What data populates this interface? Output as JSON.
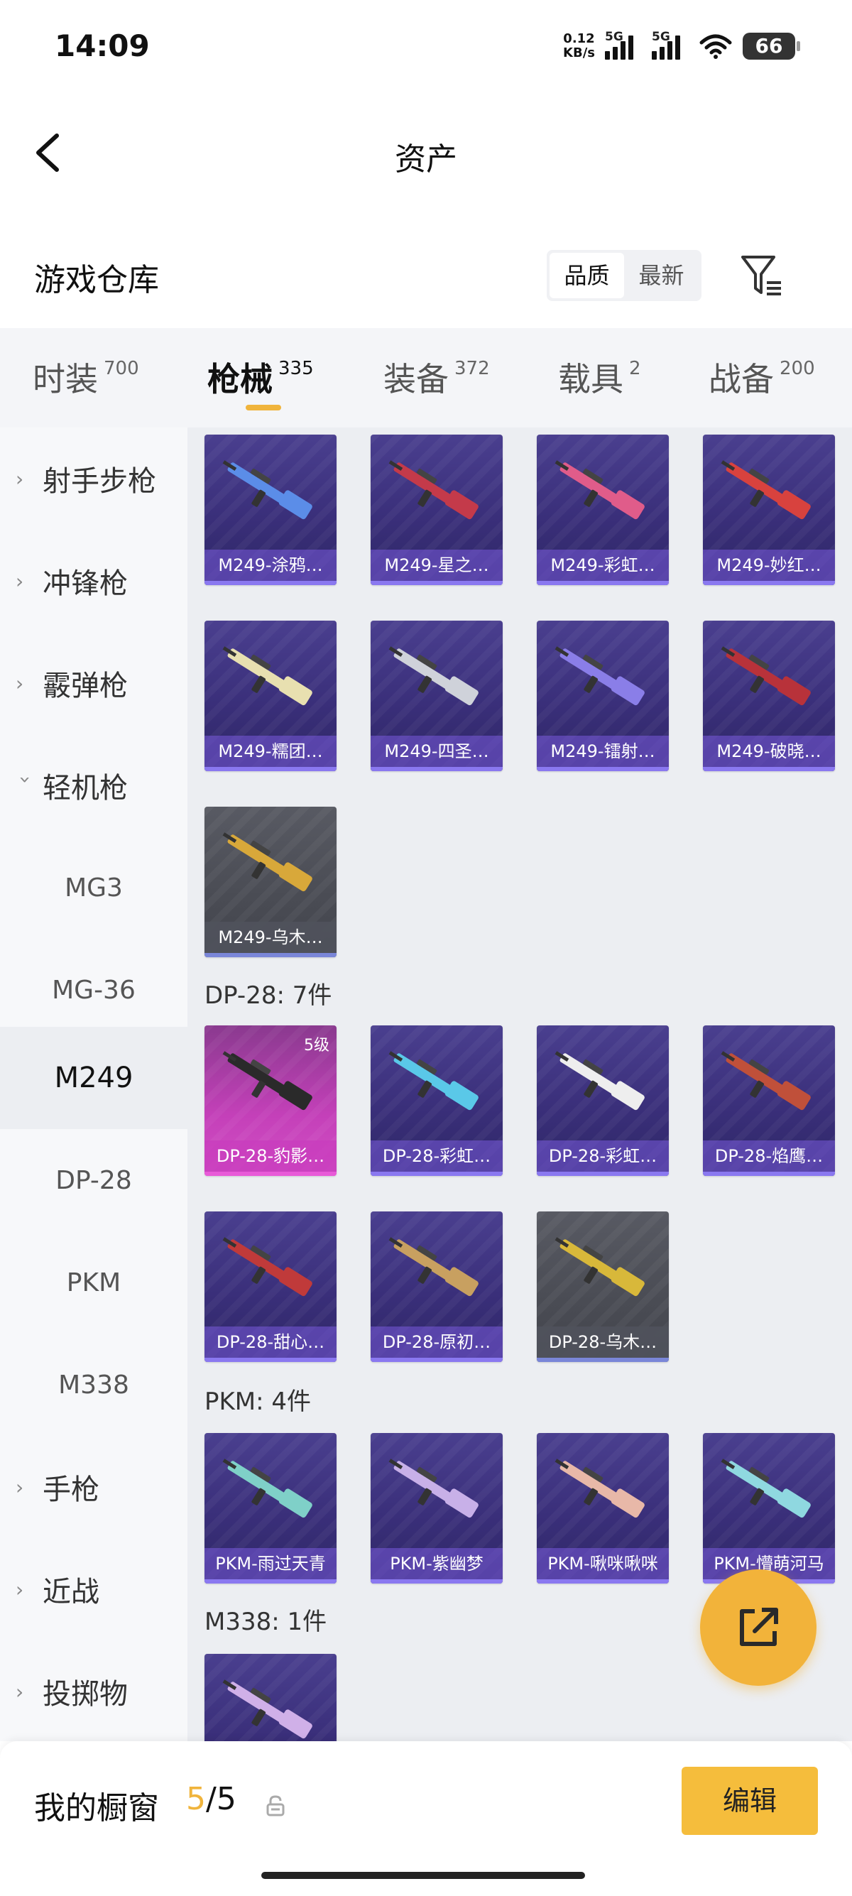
{
  "status_bar": {
    "time": "14:09",
    "net_speed_value": "0.12",
    "net_speed_unit": "KB/s",
    "sig1": "5G",
    "sig2": "5G",
    "battery": "66"
  },
  "nav": {
    "title": "资产"
  },
  "warehouse": {
    "title": "游戏仓库",
    "sort_quality": "品质",
    "sort_newest": "最新"
  },
  "tabs": [
    {
      "label": "时装",
      "count": "700"
    },
    {
      "label": "枪械",
      "count": "335"
    },
    {
      "label": "装备",
      "count": "372"
    },
    {
      "label": "载具",
      "count": "2"
    },
    {
      "label": "战备",
      "count": "200"
    }
  ],
  "sidebar": [
    {
      "label": "射手步枪"
    },
    {
      "label": "冲锋枪"
    },
    {
      "label": "霰弹枪"
    },
    {
      "label": "轻机枪"
    },
    {
      "label": "MG3"
    },
    {
      "label": "MG-36"
    },
    {
      "label": "M249"
    },
    {
      "label": "DP-28"
    },
    {
      "label": "PKM"
    },
    {
      "label": "M338"
    },
    {
      "label": "手枪"
    },
    {
      "label": "近战"
    },
    {
      "label": "投掷物"
    }
  ],
  "sections": {
    "dp28": "DP-28: 7件",
    "pkm": "PKM: 4件",
    "m338": "M338: 1件"
  },
  "cards": [
    {
      "name": "M249-涂鸦…"
    },
    {
      "name": "M249-星之…"
    },
    {
      "name": "M249-彩虹…"
    },
    {
      "name": "M249-妙红…"
    },
    {
      "name": "M249-糯团…"
    },
    {
      "name": "M249-四圣…"
    },
    {
      "name": "M249-镭射…"
    },
    {
      "name": "M249-破晓…"
    },
    {
      "name": "M249-乌木…"
    },
    {
      "name": "DP-28-豹影…",
      "level": "5级"
    },
    {
      "name": "DP-28-彩虹…"
    },
    {
      "name": "DP-28-彩虹…"
    },
    {
      "name": "DP-28-焰鹰…"
    },
    {
      "name": "DP-28-甜心…"
    },
    {
      "name": "DP-28-原初…"
    },
    {
      "name": "DP-28-乌木…"
    },
    {
      "name": "PKM-雨过天青"
    },
    {
      "name": "PKM-紫幽梦"
    },
    {
      "name": "PKM-啾咪啾咪"
    },
    {
      "name": "PKM-懵萌河马"
    },
    {
      "name": ""
    }
  ],
  "showcase": {
    "label": "我的橱窗",
    "current": "5",
    "total": "/5",
    "edit_label": "编辑"
  },
  "colors": {
    "accent": "#f0b43c",
    "card_purple": "#3a2f7a",
    "card_grey": "#4a4c54",
    "card_pink": "#c440b9"
  }
}
